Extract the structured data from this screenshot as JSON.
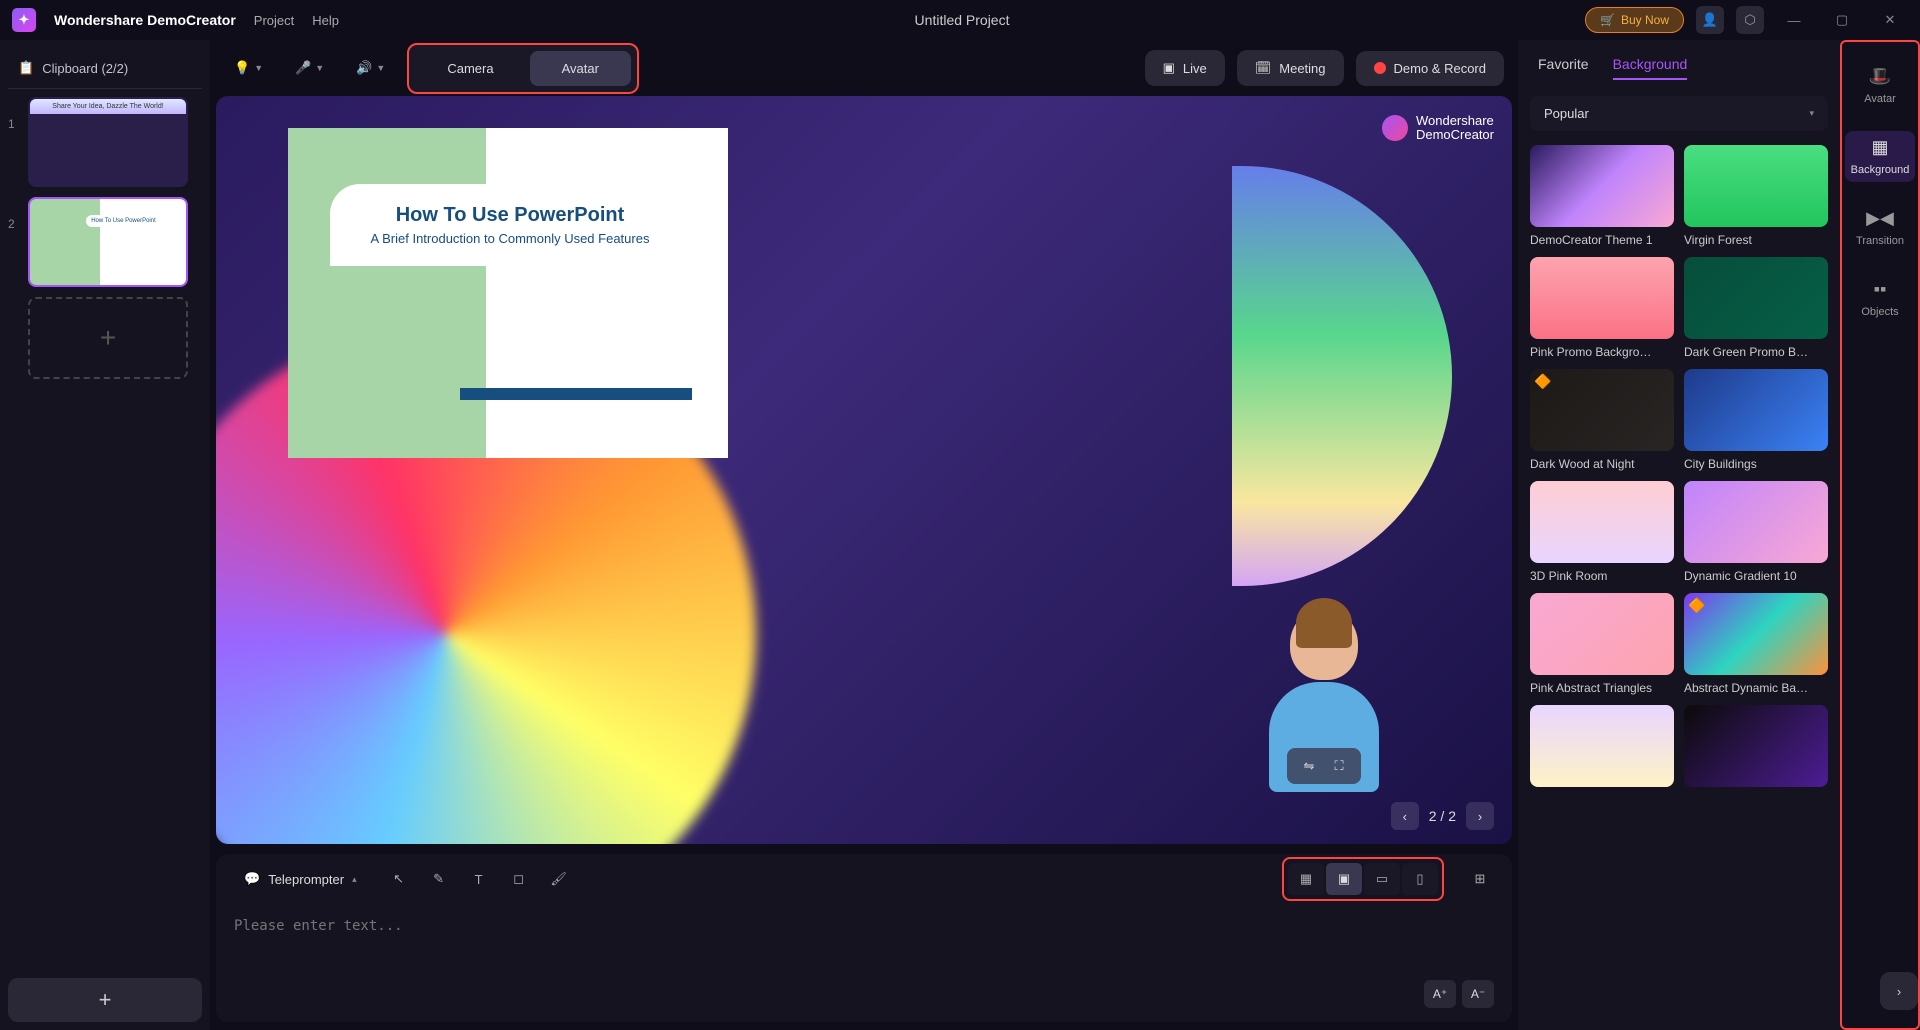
{
  "app": {
    "name": "Wondershare DemoCreator",
    "menu_project": "Project",
    "menu_help": "Help"
  },
  "title": "Untitled Project",
  "titlebar": {
    "buy": "Buy Now"
  },
  "clipboard": {
    "label": "Clipboard (2/2)",
    "slides": [
      {
        "num": "1",
        "thumb_title": "Share Your Idea, Dazzle The World!"
      },
      {
        "num": "2",
        "thumb_title": "How To Use PowerPoint"
      }
    ]
  },
  "toolbar": {
    "camera": "Camera",
    "avatar": "Avatar",
    "live": "Live",
    "meeting": "Meeting",
    "demo_record": "Demo & Record"
  },
  "canvas": {
    "slide_title": "How To Use PowerPoint",
    "slide_subtitle": "A Brief Introduction to Commonly Used Features",
    "watermark_line1": "Wondershare",
    "watermark_line2": "DemoCreator",
    "page": "2 / 2"
  },
  "bottombar": {
    "teleprompter": "Teleprompter",
    "placeholder": "Please enter text...",
    "font_up": "A⁺",
    "font_down": "A⁻"
  },
  "right": {
    "tabs": {
      "favorite": "Favorite",
      "background": "Background"
    },
    "dropdown": "Popular",
    "backgrounds": [
      {
        "label": "DemoCreator Theme 1",
        "vip": false
      },
      {
        "label": "Virgin Forest",
        "vip": false
      },
      {
        "label": "Pink Promo Backgro…",
        "vip": false
      },
      {
        "label": "Dark Green Promo B…",
        "vip": false
      },
      {
        "label": "Dark Wood at Night",
        "vip": true
      },
      {
        "label": "City Buildings",
        "vip": false
      },
      {
        "label": "3D Pink Room",
        "vip": false
      },
      {
        "label": "Dynamic Gradient 10",
        "vip": false
      },
      {
        "label": "Pink Abstract Triangles",
        "vip": false
      },
      {
        "label": "Abstract Dynamic Ba…",
        "vip": true
      },
      {
        "label": "",
        "vip": false
      },
      {
        "label": "",
        "vip": false
      }
    ]
  },
  "far_right": {
    "avatar": "Avatar",
    "background": "Background",
    "transition": "Transition",
    "objects": "Objects"
  }
}
